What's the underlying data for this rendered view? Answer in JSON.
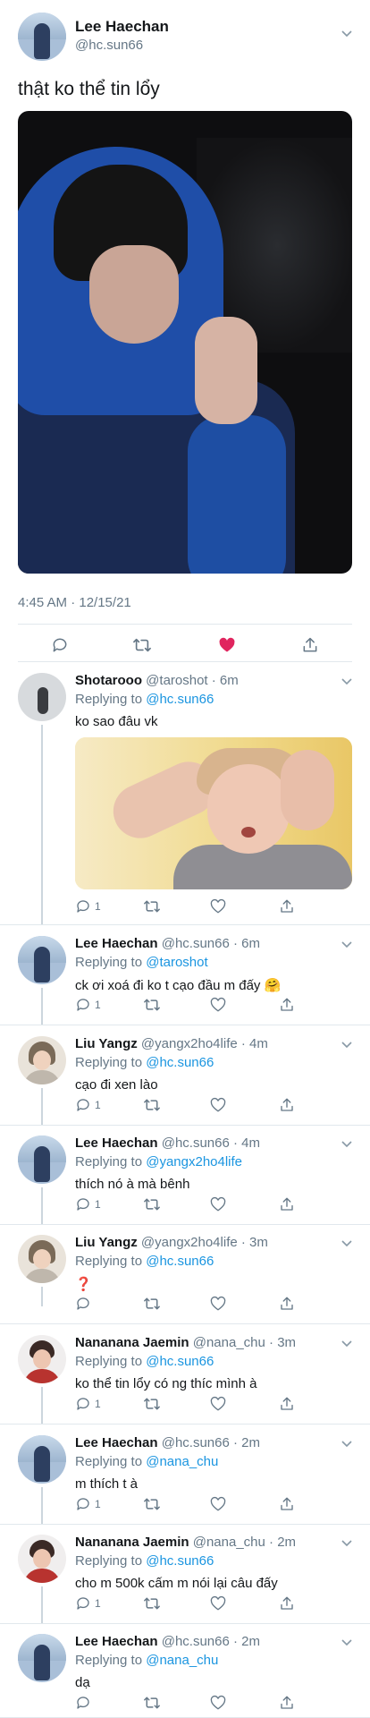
{
  "main_tweet": {
    "author_name": "Lee Haechan",
    "author_handle": "@hc.sun66",
    "text": "thật ko thể tin lổy",
    "timestamp": "4:45 AM · 12/15/21",
    "liked": true,
    "like_color": "#e0245e"
  },
  "replies": [
    {
      "name": "Shotarooo",
      "meta": "@taroshot · 6m",
      "replying_prefix": "Replying to ",
      "replying_to": "@hc.sun66",
      "text": "ko sao đâu vk",
      "reply_count": "1",
      "has_photo": true
    },
    {
      "name": "Lee Haechan",
      "meta": "@hc.sun66 · 6m",
      "replying_prefix": "Replying to ",
      "replying_to": "@taroshot",
      "text": "ck ơi xoá đi ko t cạo đầu m đấy 🤗",
      "reply_count": "1"
    },
    {
      "name": "Liu Yangz",
      "meta": "@yangx2ho4life · 4m",
      "replying_prefix": "Replying to ",
      "replying_to": "@hc.sun66",
      "text": "cạo đi xen lào",
      "reply_count": "1"
    },
    {
      "name": "Lee Haechan",
      "meta": "@hc.sun66 · 4m",
      "replying_prefix": "Replying to ",
      "replying_to": "@yangx2ho4life",
      "text": "thích nó à mà bênh",
      "reply_count": "1"
    },
    {
      "name": "Liu Yangz",
      "meta": "@yangx2ho4life · 3m",
      "replying_prefix": "Replying to ",
      "replying_to": "@hc.sun66",
      "text": "❓",
      "reply_count": ""
    },
    {
      "name": "Nananana Jaemin",
      "meta": "@nana_chu · 3m",
      "replying_prefix": "Replying to ",
      "replying_to": "@hc.sun66",
      "text": "ko thể tin lổy có ng thíc mình à",
      "reply_count": "1"
    },
    {
      "name": "Lee Haechan",
      "meta": "@hc.sun66 · 2m",
      "replying_prefix": "Replying to ",
      "replying_to": "@nana_chu",
      "text": "m thích t à",
      "reply_count": "1"
    },
    {
      "name": "Nananana Jaemin",
      "meta": "@nana_chu · 2m",
      "replying_prefix": "Replying to ",
      "replying_to": "@hc.sun66",
      "text": "cho m 500k cấm m nói lại câu đấy",
      "reply_count": "1"
    },
    {
      "name": "Lee Haechan",
      "meta": "@hc.sun66 · 2m",
      "replying_prefix": "Replying to ",
      "replying_to": "@nana_chu",
      "text": "dạ",
      "reply_count": ""
    }
  ],
  "colors": {
    "link": "#1b95e0",
    "muted": "#657786",
    "text": "#14171a",
    "like": "#e0245e",
    "thread_line": "#ccd6dd"
  },
  "icons": [
    "reply-icon",
    "retweet-icon",
    "like-icon",
    "share-icon",
    "chevron-down-icon"
  ]
}
